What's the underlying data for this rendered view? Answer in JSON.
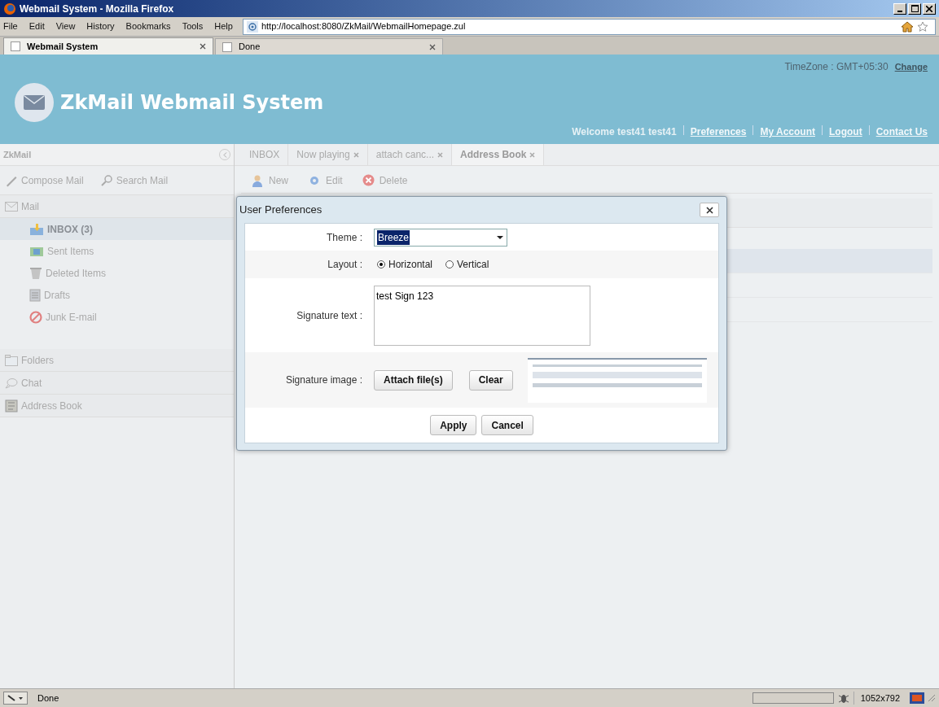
{
  "browser": {
    "title": "Webmail System - Mozilla Firefox",
    "menu": [
      "File",
      "Edit",
      "View",
      "History",
      "Bookmarks",
      "Tools",
      "Help"
    ],
    "url": "http://localhost:8080/ZkMail/WebmailHomepage.zul",
    "tabs": [
      {
        "label": "Webmail System",
        "selected": true
      },
      {
        "label": "Done",
        "selected": false
      }
    ],
    "status_text": "Done",
    "resolution": "1052x792"
  },
  "header": {
    "title": "ZkMail Webmail System",
    "timezone": "TimeZone : GMT+05:30",
    "change_link": "Change",
    "welcome": "Welcome test41 test41",
    "links": [
      "Preferences",
      "My Account",
      "Logout",
      "Contact Us"
    ]
  },
  "sidebar": {
    "title": "ZkMail",
    "actions": [
      {
        "label": "Compose Mail",
        "kind": "compose"
      },
      {
        "label": "Search Mail",
        "kind": "search"
      }
    ],
    "sections": [
      {
        "label": "Mail",
        "kind": "mail",
        "items": [
          {
            "label": "INBOX (3)",
            "kind": "inbox",
            "selected": true
          },
          {
            "label": "Sent Items",
            "kind": "sent",
            "selected": false
          },
          {
            "label": "Deleted Items",
            "kind": "deleted",
            "selected": false
          },
          {
            "label": "Drafts",
            "kind": "drafts",
            "selected": false
          },
          {
            "label": "Junk E-mail",
            "kind": "junk",
            "selected": false
          }
        ]
      },
      {
        "label": "Folders",
        "kind": "folders"
      },
      {
        "label": "Chat",
        "kind": "chat"
      },
      {
        "label": "Address Book",
        "kind": "addressbook"
      }
    ]
  },
  "content_tabs": [
    {
      "label": "INBOX",
      "closable": false,
      "selected": false
    },
    {
      "label": "Now playing",
      "closable": true,
      "selected": false
    },
    {
      "label": "attach canc...",
      "closable": true,
      "selected": false
    },
    {
      "label": "Address Book",
      "closable": true,
      "selected": true
    }
  ],
  "toolbar": [
    {
      "label": "New",
      "kind": "new"
    },
    {
      "label": "Edit",
      "kind": "edit"
    },
    {
      "label": "Delete",
      "kind": "delete"
    }
  ],
  "grid": {
    "rows": [
      {
        "selected": true
      },
      {
        "selected": false
      },
      {
        "selected": false
      }
    ]
  },
  "dialog": {
    "title": "User Preferences",
    "theme_label": "Theme :",
    "theme_value": "Breeze",
    "layout_label": "Layout :",
    "layout_options": [
      {
        "label": "Horizontal",
        "selected": true
      },
      {
        "label": "Vertical",
        "selected": false
      }
    ],
    "signature_text_label": "Signature text :",
    "signature_text": "test Sign 123",
    "signature_image_label": "Signature image :",
    "image_buttons": [
      "Attach file(s)",
      "Clear"
    ],
    "buttons": [
      "Apply",
      "Cancel"
    ]
  }
}
